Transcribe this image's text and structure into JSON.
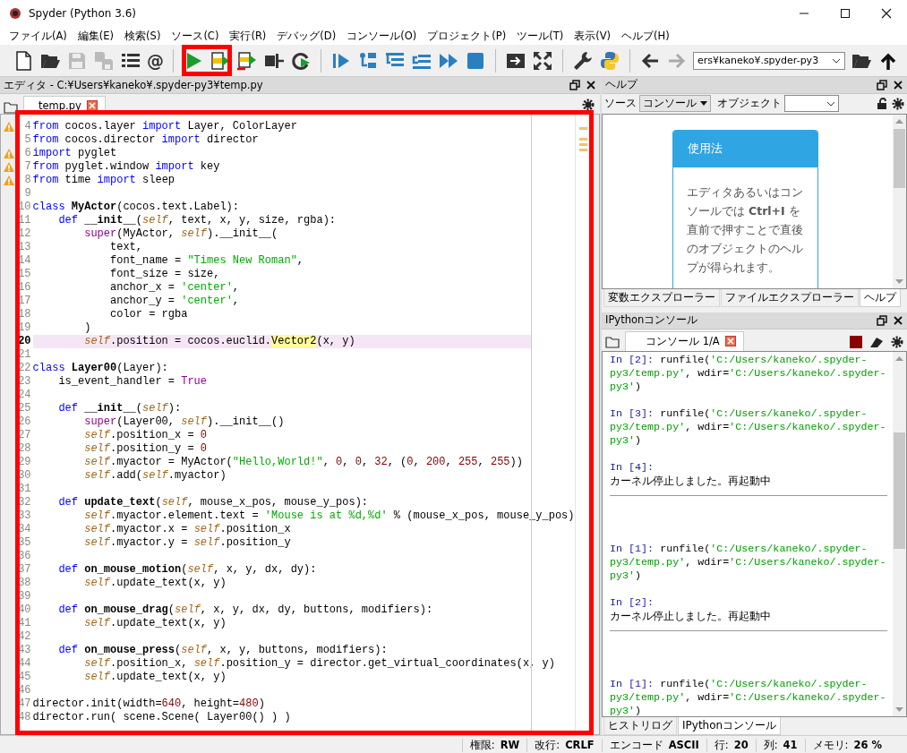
{
  "window": {
    "title": "Spyder (Python 3.6)"
  },
  "menu": [
    "ファイル(A)",
    "編集(E)",
    "検索(S)",
    "ソース(C)",
    "実行(R)",
    "デバッグ(D)",
    "コンソール(O)",
    "プロジェクト(P)",
    "ツール(T)",
    "表示(V)",
    "ヘルプ(H)"
  ],
  "toolbar": {
    "at_sign": "@",
    "path": "ers¥kaneko¥.spyder-py3"
  },
  "editor": {
    "title": "エディタ - C:¥Users¥kaneko¥.spyder-py3¥temp.py",
    "tab": "temp.py",
    "lines": [
      {
        "number": "4",
        "warning": true,
        "current": false,
        "tokens": [
          {
            "kind": "kw",
            "text": "from"
          },
          {
            "kind": "plain",
            "text": " cocos.layer "
          },
          {
            "kind": "kw",
            "text": "import"
          },
          {
            "kind": "plain",
            "text": " Layer, ColorLayer"
          }
        ]
      },
      {
        "number": "5",
        "warning": false,
        "current": false,
        "tokens": [
          {
            "kind": "kw",
            "text": "from"
          },
          {
            "kind": "plain",
            "text": " cocos.director "
          },
          {
            "kind": "kw",
            "text": "import"
          },
          {
            "kind": "plain",
            "text": " director"
          }
        ]
      },
      {
        "number": "6",
        "warning": true,
        "current": false,
        "tokens": [
          {
            "kind": "kw",
            "text": "import"
          },
          {
            "kind": "plain",
            "text": " pyglet"
          }
        ]
      },
      {
        "number": "7",
        "warning": true,
        "current": false,
        "tokens": [
          {
            "kind": "kw",
            "text": "from"
          },
          {
            "kind": "plain",
            "text": " pyglet.window "
          },
          {
            "kind": "kw",
            "text": "import"
          },
          {
            "kind": "plain",
            "text": " key"
          }
        ]
      },
      {
        "number": "8",
        "warning": true,
        "current": false,
        "tokens": [
          {
            "kind": "kw",
            "text": "from"
          },
          {
            "kind": "plain",
            "text": " time "
          },
          {
            "kind": "kw",
            "text": "import"
          },
          {
            "kind": "plain",
            "text": " sleep"
          }
        ]
      },
      {
        "number": "9",
        "warning": false,
        "current": false
      },
      {
        "number": "10",
        "warning": false,
        "current": false,
        "tokens": [
          {
            "kind": "kw",
            "text": "class"
          },
          {
            "kind": "def",
            "text": " MyActor"
          },
          {
            "kind": "plain",
            "text": "(cocos.text.Label):"
          }
        ]
      },
      {
        "number": "11",
        "warning": false,
        "current": false,
        "tokens": [
          {
            "kind": "kw",
            "text": "    def"
          },
          {
            "kind": "def",
            "text": " __init__"
          },
          {
            "kind": "plain",
            "text": "("
          },
          {
            "kind": "self",
            "text": "self"
          },
          {
            "kind": "plain",
            "text": ", text, x, y, size, rgba):"
          }
        ]
      },
      {
        "number": "12",
        "warning": false,
        "current": false,
        "tokens": [
          {
            "kind": "builtin",
            "text": "        super"
          },
          {
            "kind": "plain",
            "text": "(MyActor, "
          },
          {
            "kind": "self",
            "text": "self"
          },
          {
            "kind": "plain",
            "text": ").__init__("
          }
        ]
      },
      {
        "number": "13",
        "warning": false,
        "current": false,
        "tokens": [
          {
            "kind": "plain",
            "text": "            text,"
          }
        ]
      },
      {
        "number": "14",
        "warning": false,
        "current": false,
        "tokens": [
          {
            "kind": "plain",
            "text": "            font_name = "
          },
          {
            "kind": "str",
            "text": "\"Times New Roman\""
          },
          {
            "kind": "plain",
            "text": ","
          }
        ]
      },
      {
        "number": "15",
        "warning": false,
        "current": false,
        "tokens": [
          {
            "kind": "plain",
            "text": "            font_size = size,"
          }
        ]
      },
      {
        "number": "16",
        "warning": false,
        "current": false,
        "tokens": [
          {
            "kind": "plain",
            "text": "            anchor_x = "
          },
          {
            "kind": "str",
            "text": "'center'"
          },
          {
            "kind": "plain",
            "text": ","
          }
        ]
      },
      {
        "number": "17",
        "warning": false,
        "current": false,
        "tokens": [
          {
            "kind": "plain",
            "text": "            anchor_y = "
          },
          {
            "kind": "str",
            "text": "'center'"
          },
          {
            "kind": "plain",
            "text": ","
          }
        ]
      },
      {
        "number": "18",
        "warning": false,
        "current": false,
        "tokens": [
          {
            "kind": "plain",
            "text": "            color = rgba"
          }
        ]
      },
      {
        "number": "19",
        "warning": false,
        "current": false,
        "tokens": [
          {
            "kind": "plain",
            "text": "        )"
          }
        ]
      },
      {
        "number": "20",
        "warning": false,
        "current": true,
        "tokens": [
          {
            "kind": "self",
            "text": "        self"
          },
          {
            "kind": "plain",
            "text": ".position = cocos.euclid."
          },
          {
            "kind": "hl",
            "text": "Vector2"
          },
          {
            "kind": "plain",
            "text": "(x, y)"
          }
        ]
      },
      {
        "number": "21",
        "warning": false,
        "current": false
      },
      {
        "number": "22",
        "warning": false,
        "current": false,
        "tokens": [
          {
            "kind": "kw",
            "text": "class"
          },
          {
            "kind": "def",
            "text": " Layer00"
          },
          {
            "kind": "plain",
            "text": "(Layer):"
          }
        ]
      },
      {
        "number": "23",
        "warning": false,
        "current": false,
        "tokens": [
          {
            "kind": "plain",
            "text": "    is_event_handler = "
          },
          {
            "kind": "builtin",
            "text": "True"
          }
        ]
      },
      {
        "number": "24",
        "warning": false,
        "current": false
      },
      {
        "number": "25",
        "warning": false,
        "current": false,
        "tokens": [
          {
            "kind": "kw",
            "text": "    def"
          },
          {
            "kind": "def",
            "text": " __init__"
          },
          {
            "kind": "plain",
            "text": "("
          },
          {
            "kind": "self",
            "text": "self"
          },
          {
            "kind": "plain",
            "text": "):"
          }
        ]
      },
      {
        "number": "26",
        "warning": false,
        "current": false,
        "tokens": [
          {
            "kind": "builtin",
            "text": "        super"
          },
          {
            "kind": "plain",
            "text": "(Layer00, "
          },
          {
            "kind": "self",
            "text": "self"
          },
          {
            "kind": "plain",
            "text": ").__init__()"
          }
        ]
      },
      {
        "number": "27",
        "warning": false,
        "current": false,
        "tokens": [
          {
            "kind": "self",
            "text": "        self"
          },
          {
            "kind": "plain",
            "text": ".position_x = "
          },
          {
            "kind": "num",
            "text": "0"
          }
        ]
      },
      {
        "number": "28",
        "warning": false,
        "current": false,
        "tokens": [
          {
            "kind": "self",
            "text": "        self"
          },
          {
            "kind": "plain",
            "text": ".position_y = "
          },
          {
            "kind": "num",
            "text": "0"
          }
        ]
      },
      {
        "number": "29",
        "warning": false,
        "current": false,
        "tokens": [
          {
            "kind": "self",
            "text": "        self"
          },
          {
            "kind": "plain",
            "text": ".myactor = MyActor("
          },
          {
            "kind": "str",
            "text": "\"Hello,World!\""
          },
          {
            "kind": "plain",
            "text": ", "
          },
          {
            "kind": "num",
            "text": "0"
          },
          {
            "kind": "plain",
            "text": ", "
          },
          {
            "kind": "num",
            "text": "0"
          },
          {
            "kind": "plain",
            "text": ", "
          },
          {
            "kind": "num",
            "text": "32"
          },
          {
            "kind": "plain",
            "text": ", ("
          },
          {
            "kind": "num",
            "text": "0"
          },
          {
            "kind": "plain",
            "text": ", "
          },
          {
            "kind": "num",
            "text": "200"
          },
          {
            "kind": "plain",
            "text": ", "
          },
          {
            "kind": "num",
            "text": "255"
          },
          {
            "kind": "plain",
            "text": ", "
          },
          {
            "kind": "num",
            "text": "255"
          },
          {
            "kind": "plain",
            "text": "))"
          }
        ]
      },
      {
        "number": "30",
        "warning": false,
        "current": false,
        "tokens": [
          {
            "kind": "self",
            "text": "        self"
          },
          {
            "kind": "plain",
            "text": ".add("
          },
          {
            "kind": "self",
            "text": "self"
          },
          {
            "kind": "plain",
            "text": ".myactor)"
          }
        ]
      },
      {
        "number": "31",
        "warning": false,
        "current": false
      },
      {
        "number": "32",
        "warning": false,
        "current": false,
        "tokens": [
          {
            "kind": "kw",
            "text": "    def"
          },
          {
            "kind": "def",
            "text": " update_text"
          },
          {
            "kind": "plain",
            "text": "("
          },
          {
            "kind": "self",
            "text": "self"
          },
          {
            "kind": "plain",
            "text": ", mouse_x_pos, mouse_y_pos):"
          }
        ]
      },
      {
        "number": "33",
        "warning": false,
        "current": false,
        "tokens": [
          {
            "kind": "self",
            "text": "        self"
          },
          {
            "kind": "plain",
            "text": ".myactor.element.text = "
          },
          {
            "kind": "str",
            "text": "'Mouse is at %d,%d'"
          },
          {
            "kind": "plain",
            "text": " % (mouse_x_pos, mouse_y_pos)"
          }
        ]
      },
      {
        "number": "34",
        "warning": false,
        "current": false,
        "tokens": [
          {
            "kind": "self",
            "text": "        self"
          },
          {
            "kind": "plain",
            "text": ".myactor.x = "
          },
          {
            "kind": "self",
            "text": "self"
          },
          {
            "kind": "plain",
            "text": ".position_x"
          }
        ]
      },
      {
        "number": "35",
        "warning": false,
        "current": false,
        "tokens": [
          {
            "kind": "self",
            "text": "        self"
          },
          {
            "kind": "plain",
            "text": ".myactor.y = "
          },
          {
            "kind": "self",
            "text": "self"
          },
          {
            "kind": "plain",
            "text": ".position_y"
          }
        ]
      },
      {
        "number": "36",
        "warning": false,
        "current": false
      },
      {
        "number": "37",
        "warning": false,
        "current": false,
        "tokens": [
          {
            "kind": "kw",
            "text": "    def"
          },
          {
            "kind": "def",
            "text": " on_mouse_motion"
          },
          {
            "kind": "plain",
            "text": "("
          },
          {
            "kind": "self",
            "text": "self"
          },
          {
            "kind": "plain",
            "text": ", x, y, dx, dy):"
          }
        ]
      },
      {
        "number": "38",
        "warning": false,
        "current": false,
        "tokens": [
          {
            "kind": "self",
            "text": "        self"
          },
          {
            "kind": "plain",
            "text": ".update_text(x, y)"
          }
        ]
      },
      {
        "number": "39",
        "warning": false,
        "current": false
      },
      {
        "number": "40",
        "warning": false,
        "current": false,
        "tokens": [
          {
            "kind": "kw",
            "text": "    def"
          },
          {
            "kind": "def",
            "text": " on_mouse_drag"
          },
          {
            "kind": "plain",
            "text": "("
          },
          {
            "kind": "self",
            "text": "self"
          },
          {
            "kind": "plain",
            "text": ", x, y, dx, dy, buttons, modifiers):"
          }
        ]
      },
      {
        "number": "41",
        "warning": false,
        "current": false,
        "tokens": [
          {
            "kind": "self",
            "text": "        self"
          },
          {
            "kind": "plain",
            "text": ".update_text(x, y)"
          }
        ]
      },
      {
        "number": "42",
        "warning": false,
        "current": false
      },
      {
        "number": "43",
        "warning": false,
        "current": false,
        "tokens": [
          {
            "kind": "kw",
            "text": "    def"
          },
          {
            "kind": "def",
            "text": " on_mouse_press"
          },
          {
            "kind": "plain",
            "text": "("
          },
          {
            "kind": "self",
            "text": "self"
          },
          {
            "kind": "plain",
            "text": ", x, y, buttons, modifiers):"
          }
        ]
      },
      {
        "number": "44",
        "warning": false,
        "current": false,
        "tokens": [
          {
            "kind": "self",
            "text": "        self"
          },
          {
            "kind": "plain",
            "text": ".position_x, "
          },
          {
            "kind": "self",
            "text": "self"
          },
          {
            "kind": "plain",
            "text": ".position_y = director.get_virtual_coordinates(x, y)"
          }
        ]
      },
      {
        "number": "45",
        "warning": false,
        "current": false,
        "tokens": [
          {
            "kind": "self",
            "text": "        self"
          },
          {
            "kind": "plain",
            "text": ".update_text(x, y)"
          }
        ]
      },
      {
        "number": "46",
        "warning": false,
        "current": false
      },
      {
        "number": "47",
        "warning": false,
        "current": false,
        "tokens": [
          {
            "kind": "plain",
            "text": "director.init(width="
          },
          {
            "kind": "num",
            "text": "640"
          },
          {
            "kind": "plain",
            "text": ", height="
          },
          {
            "kind": "num",
            "text": "480"
          },
          {
            "kind": "plain",
            "text": ")"
          }
        ]
      },
      {
        "number": "48",
        "warning": false,
        "current": false,
        "tokens": [
          {
            "kind": "plain",
            "text": "director.run( scene.Scene( Layer00() ) )"
          }
        ]
      }
    ]
  },
  "help": {
    "title": "ヘルプ",
    "source_label": "ソース",
    "source_value": "コンソール",
    "object_label": "オブジェクト",
    "card_title": "使用法",
    "card_text": "エディタあるいはコンソールでは **Ctrl+I** を直前で押すことで直後のオブジェクトのヘルプが得られます。",
    "tabs": [
      {
        "label": "変数エクスプローラー",
        "selected": false
      },
      {
        "label": "ファイルエクスプローラー",
        "selected": false
      },
      {
        "label": "ヘルプ",
        "selected": true
      }
    ]
  },
  "console": {
    "title": "IPythonコンソール",
    "tab": "コンソール 1/A",
    "entries": [
      {
        "kind": "input",
        "prompt": "In [2]:",
        "parts": [
          {
            "kind": "plain",
            "text": "runfile("
          },
          {
            "kind": "str",
            "text": "'C:/Users/kaneko/.spyder-py3/temp.py'"
          },
          {
            "kind": "plain",
            "text": ", wdir="
          },
          {
            "kind": "str",
            "text": "'C:/Users/kaneko/.spyder-py3'"
          },
          {
            "kind": "plain",
            "text": ")"
          }
        ]
      },
      {
        "kind": "input",
        "prompt": "In [3]:",
        "parts": [
          {
            "kind": "plain",
            "text": "runfile("
          },
          {
            "kind": "str",
            "text": "'C:/Users/kaneko/.spyder-py3/temp.py'"
          },
          {
            "kind": "plain",
            "text": ", wdir="
          },
          {
            "kind": "str",
            "text": "'C:/Users/kaneko/.spyder-py3'"
          },
          {
            "kind": "plain",
            "text": ")"
          }
        ]
      },
      {
        "kind": "input",
        "prompt": "In [4]:"
      },
      {
        "kind": "restart",
        "text": "カーネル停止しました。再起動中"
      },
      {
        "kind": "input",
        "prompt": "In [1]:",
        "parts": [
          {
            "kind": "plain",
            "text": "runfile("
          },
          {
            "kind": "str",
            "text": "'C:/Users/kaneko/.spyder-py3/temp.py'"
          },
          {
            "kind": "plain",
            "text": ", wdir="
          },
          {
            "kind": "str",
            "text": "'C:/Users/kaneko/.spyder-py3'"
          },
          {
            "kind": "plain",
            "text": ")"
          }
        ]
      },
      {
        "kind": "input",
        "prompt": "In [2]:"
      },
      {
        "kind": "restart",
        "text": "カーネル停止しました。再起動中"
      },
      {
        "kind": "input",
        "prompt": "In [1]:",
        "parts": [
          {
            "kind": "plain",
            "text": "runfile("
          },
          {
            "kind": "str",
            "text": "'C:/Users/kaneko/.spyder-py3/temp.py'"
          },
          {
            "kind": "plain",
            "text": ", wdir="
          },
          {
            "kind": "str",
            "text": "'C:/Users/kaneko/.spyder-py3'"
          },
          {
            "kind": "plain",
            "text": ")"
          }
        ]
      }
    ],
    "tabs": [
      {
        "label": "ヒストリログ",
        "selected": false
      },
      {
        "label": "IPythonコンソール",
        "selected": true
      }
    ]
  },
  "status_bar": [
    {
      "label": "権限:",
      "value": "RW"
    },
    {
      "label": "改行:",
      "value": "CRLF"
    },
    {
      "label": "エンコード",
      "value": "ASCII"
    },
    {
      "label": "行:",
      "value": "20"
    },
    {
      "label": "列:",
      "value": "41"
    },
    {
      "label": "メモリ:",
      "value": "26 %"
    }
  ]
}
